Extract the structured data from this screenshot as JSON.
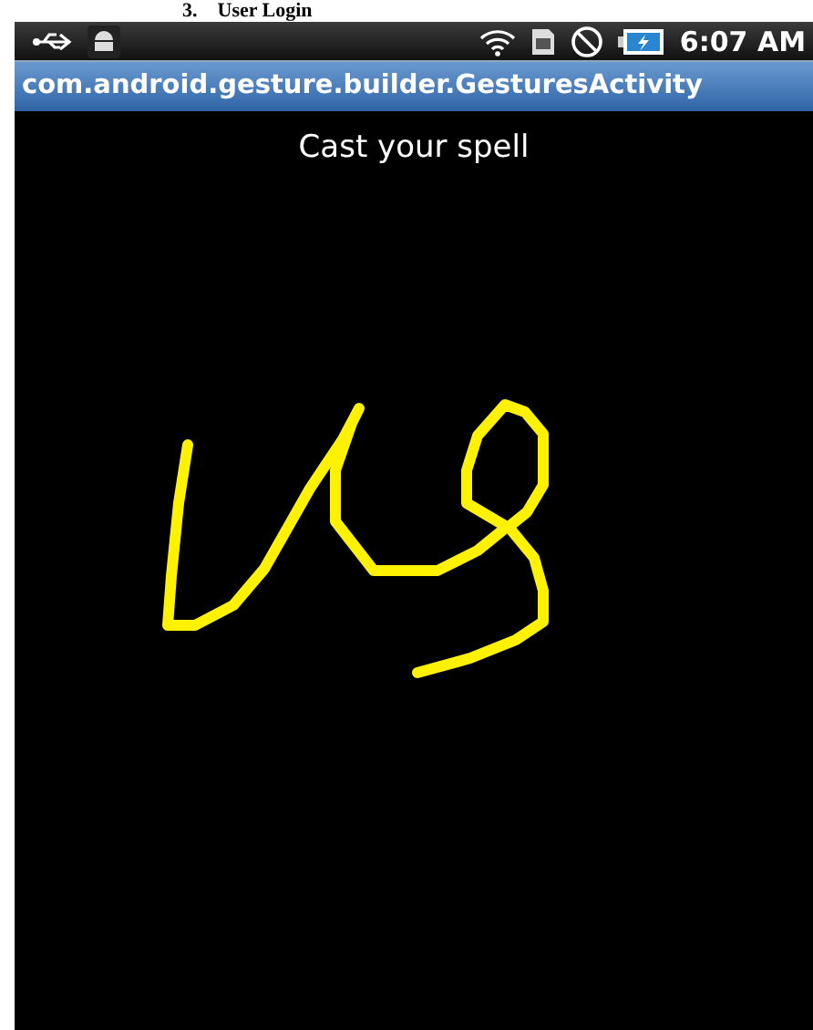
{
  "document_heading": "3.    User Login",
  "status_bar": {
    "time": "6:07 AM"
  },
  "title_bar": {
    "title": "com.android.gesture.builder.GesturesActivity"
  },
  "content": {
    "prompt": "Cast your spell"
  }
}
